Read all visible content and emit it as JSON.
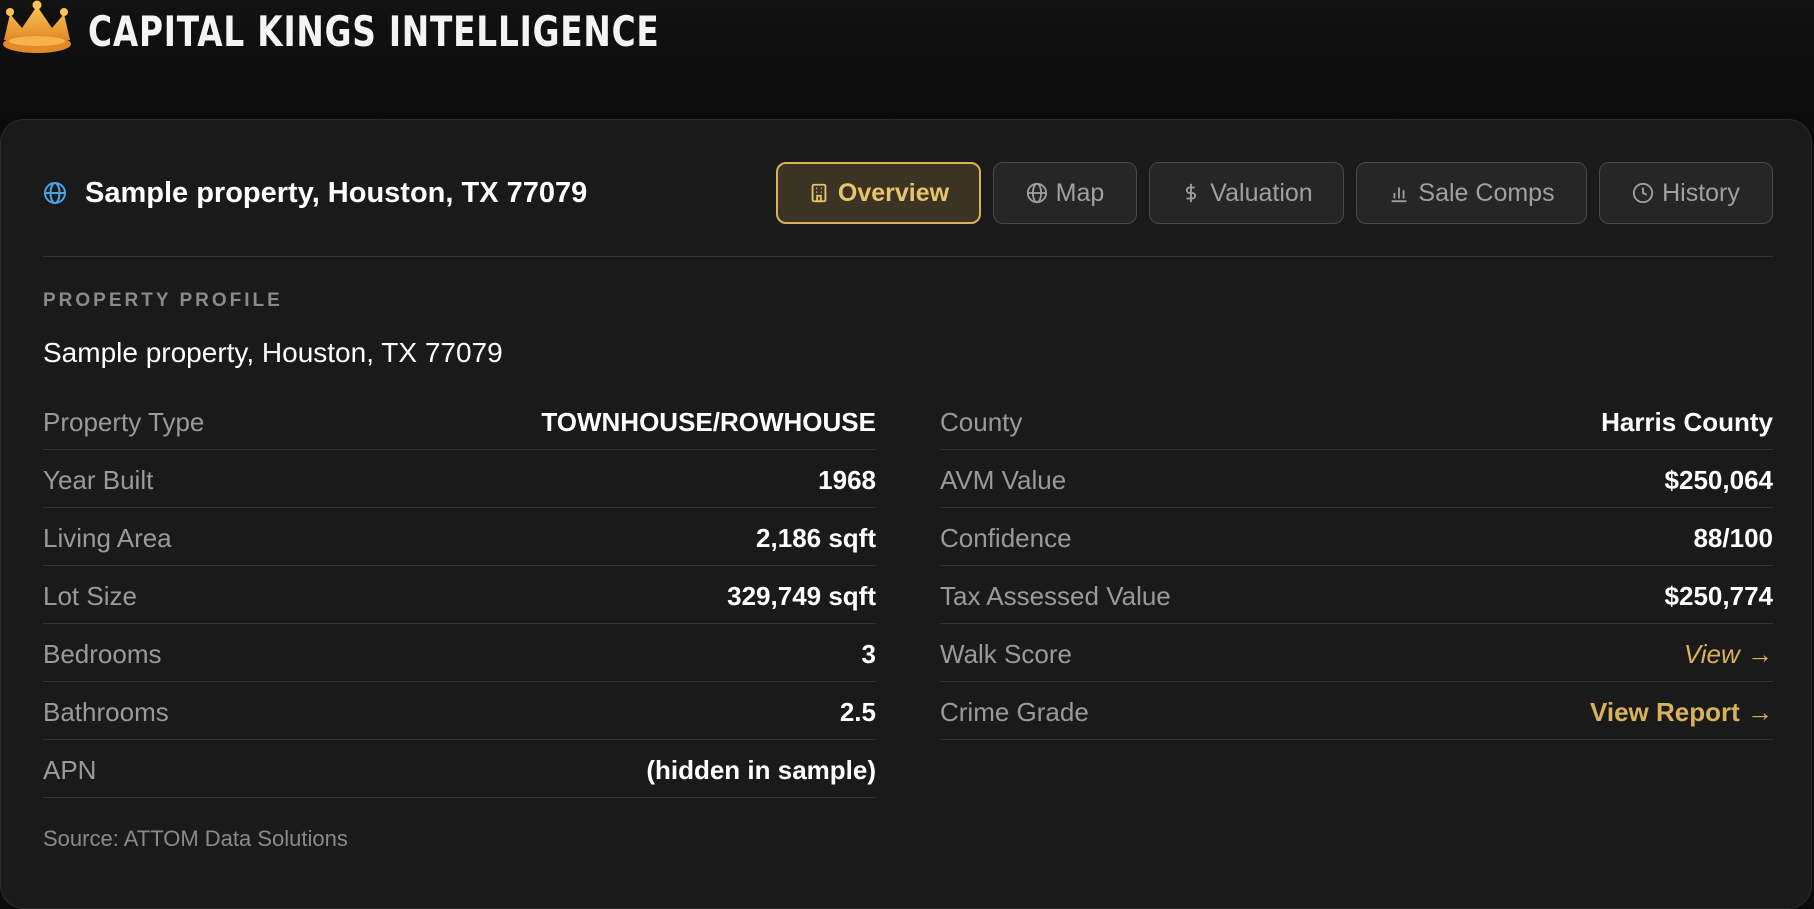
{
  "brand": {
    "title": "CAPITAL KINGS INTELLIGENCE",
    "logo_icon": "crown-icon"
  },
  "colors": {
    "accent": "#d8b25a",
    "background": "#0b0b0b",
    "card": "#1a1a1a"
  },
  "header": {
    "address": "Sample property, Houston, TX 77079",
    "icon": "globe-icon"
  },
  "tabs": [
    {
      "label": "Overview",
      "icon": "building-icon",
      "active": true
    },
    {
      "label": "Map",
      "icon": "globe-icon",
      "active": false
    },
    {
      "label": "Valuation",
      "icon": "dollar-icon",
      "active": false
    },
    {
      "label": "Sale Comps",
      "icon": "bar-chart-icon",
      "active": false
    },
    {
      "label": "History",
      "icon": "clock-icon",
      "active": false
    }
  ],
  "profile": {
    "section_label": "PROPERTY PROFILE",
    "address": "Sample property, Houston, TX 77079",
    "left": [
      {
        "label": "Property Type",
        "value": "TOWNHOUSE/ROWHOUSE"
      },
      {
        "label": "Year Built",
        "value": "1968"
      },
      {
        "label": "Living Area",
        "value": "2,186 sqft"
      },
      {
        "label": "Lot Size",
        "value": "329,749 sqft"
      },
      {
        "label": "Bedrooms",
        "value": "3"
      },
      {
        "label": "Bathrooms",
        "value": "2.5"
      },
      {
        "label": "APN",
        "value": "(hidden in sample)"
      }
    ],
    "right": [
      {
        "label": "County",
        "value": "Harris County"
      },
      {
        "label": "AVM Value",
        "value": "$250,064"
      },
      {
        "label": "Confidence",
        "value": "88/100"
      },
      {
        "label": "Tax Assessed Value",
        "value": "$250,774"
      },
      {
        "label": "Walk Score",
        "value": "View →"
      },
      {
        "label": "Crime Grade",
        "value": "View Report →"
      }
    ],
    "source": "Source: ATTOM Data Solutions"
  }
}
